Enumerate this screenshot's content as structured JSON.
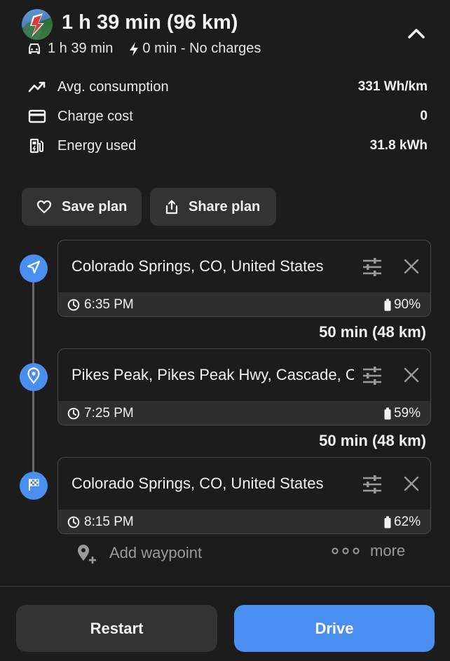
{
  "header": {
    "title": "1 h 39 min (96 km)",
    "drive_time": "1 h 39 min",
    "charge_time": "0 min - No charges",
    "logo_icon": "app-logo-lightning",
    "collapse_icon": "chevron-up-icon"
  },
  "stats": [
    {
      "icon": "trend-line-icon",
      "label": "Avg. consumption",
      "value": "331 Wh/km"
    },
    {
      "icon": "credit-card-icon",
      "label": "Charge cost",
      "value": "0"
    },
    {
      "icon": "fuel-pump-icon",
      "label": "Energy used",
      "value": "31.8 kWh"
    }
  ],
  "actions": {
    "save_label": "Save plan",
    "share_label": "Share plan"
  },
  "waypoints": [
    {
      "icon": "navigation-arrow-icon",
      "place": "Colorado Springs, CO, United States",
      "time": "6:35 PM",
      "battery": "90%"
    },
    {
      "icon": "location-pin-icon",
      "place": "Pikes Peak, Pikes Peak Hwy, Cascade, CO",
      "time": "7:25 PM",
      "battery": "59%"
    },
    {
      "icon": "checkered-flag-icon",
      "place": "Colorado Springs, CO, United States",
      "time": "8:15 PM",
      "battery": "62%"
    }
  ],
  "legs": [
    {
      "label": "50 min (48 km)"
    },
    {
      "label": "50 min (48 km)"
    }
  ],
  "add_waypoint_label": "Add waypoint",
  "more_label": "more",
  "footer": {
    "restart_label": "Restart",
    "drive_label": "Drive"
  },
  "colors": {
    "background": "#1c1c1d",
    "accent": "#4a8ff0",
    "button": "#333334",
    "card_footer": "#2e2e2f"
  }
}
